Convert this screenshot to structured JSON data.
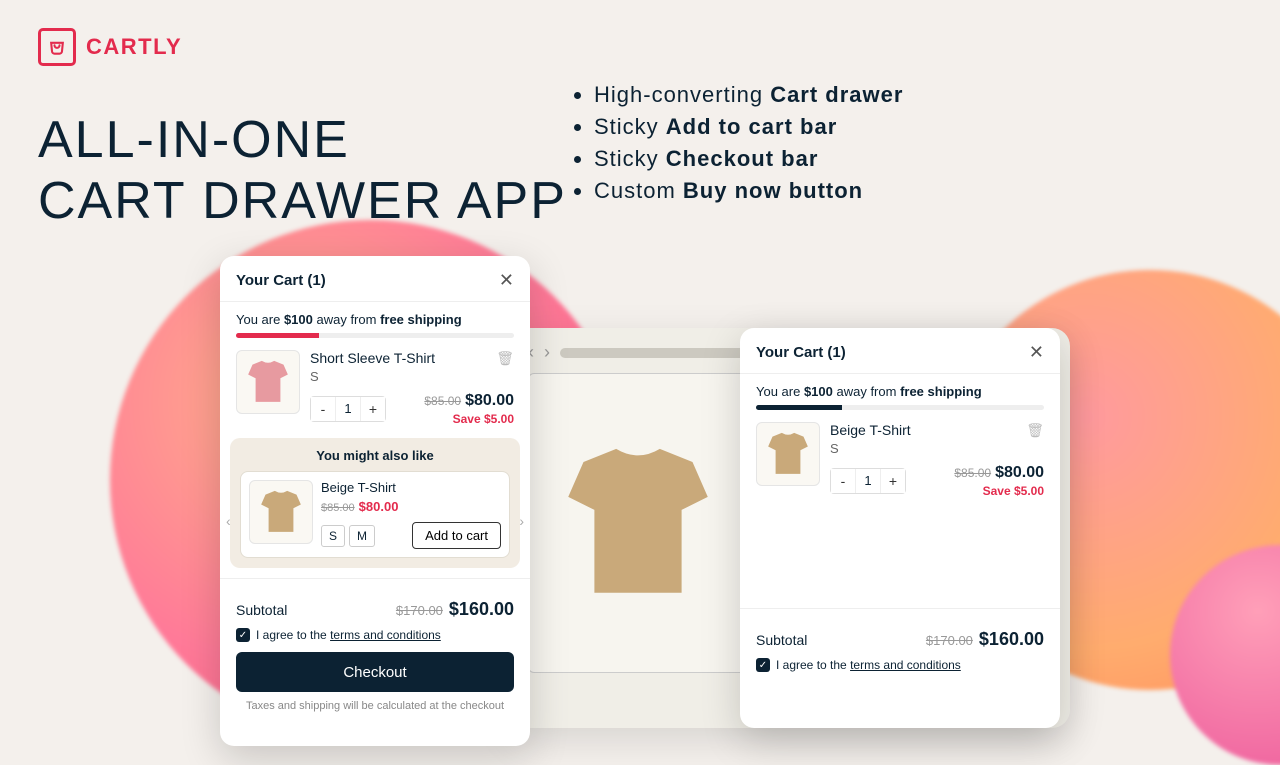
{
  "brand": {
    "name": "CARTLY"
  },
  "headline": {
    "line1": "ALL-IN-ONE",
    "line2": "CART DRAWER APP"
  },
  "bullets": [
    {
      "pre": "High-converting ",
      "bold": "Cart drawer"
    },
    {
      "pre": "Sticky ",
      "bold": "Add to cart bar"
    },
    {
      "pre": "Sticky ",
      "bold": "Checkout bar"
    },
    {
      "pre": "Custom ",
      "bold": "Buy now button"
    }
  ],
  "mock": {
    "letter": "B"
  },
  "cart_a": {
    "title": "Your Cart (1)",
    "ship_pre": "You are ",
    "ship_amount": "$100",
    "ship_mid": " away from ",
    "ship_bold": "free shipping",
    "item": {
      "name": "Short Sleeve T-Shirt",
      "variant": "S",
      "qty": "1",
      "old": "$85.00",
      "new": "$80.00",
      "save": "Save $5.00"
    },
    "upsell": {
      "head": "You might also like",
      "name": "Beige T-Shirt",
      "old": "$85.00",
      "new": "$80.00",
      "sizes": [
        "S",
        "M"
      ],
      "add": "Add to cart"
    },
    "sub_l": "Subtotal",
    "sub_old": "$170.00",
    "sub_new": "$160.00",
    "agree_pre": "I agree to the ",
    "agree_link": "terms and conditions",
    "checkout": "Checkout",
    "tax": "Taxes and shipping will be calculated at the checkout"
  },
  "cart_b": {
    "title": "Your Cart (1)",
    "ship_pre": "You are ",
    "ship_amount": "$100",
    "ship_mid": " away from ",
    "ship_bold": "free shipping",
    "item": {
      "name": "Beige T-Shirt",
      "variant": "S",
      "qty": "1",
      "old": "$85.00",
      "new": "$80.00",
      "save": "Save $5.00"
    },
    "sub_l": "Subtotal",
    "sub_old": "$170.00",
    "sub_new": "$160.00",
    "agree_pre": "I agree to the ",
    "agree_link": "terms and conditions"
  }
}
